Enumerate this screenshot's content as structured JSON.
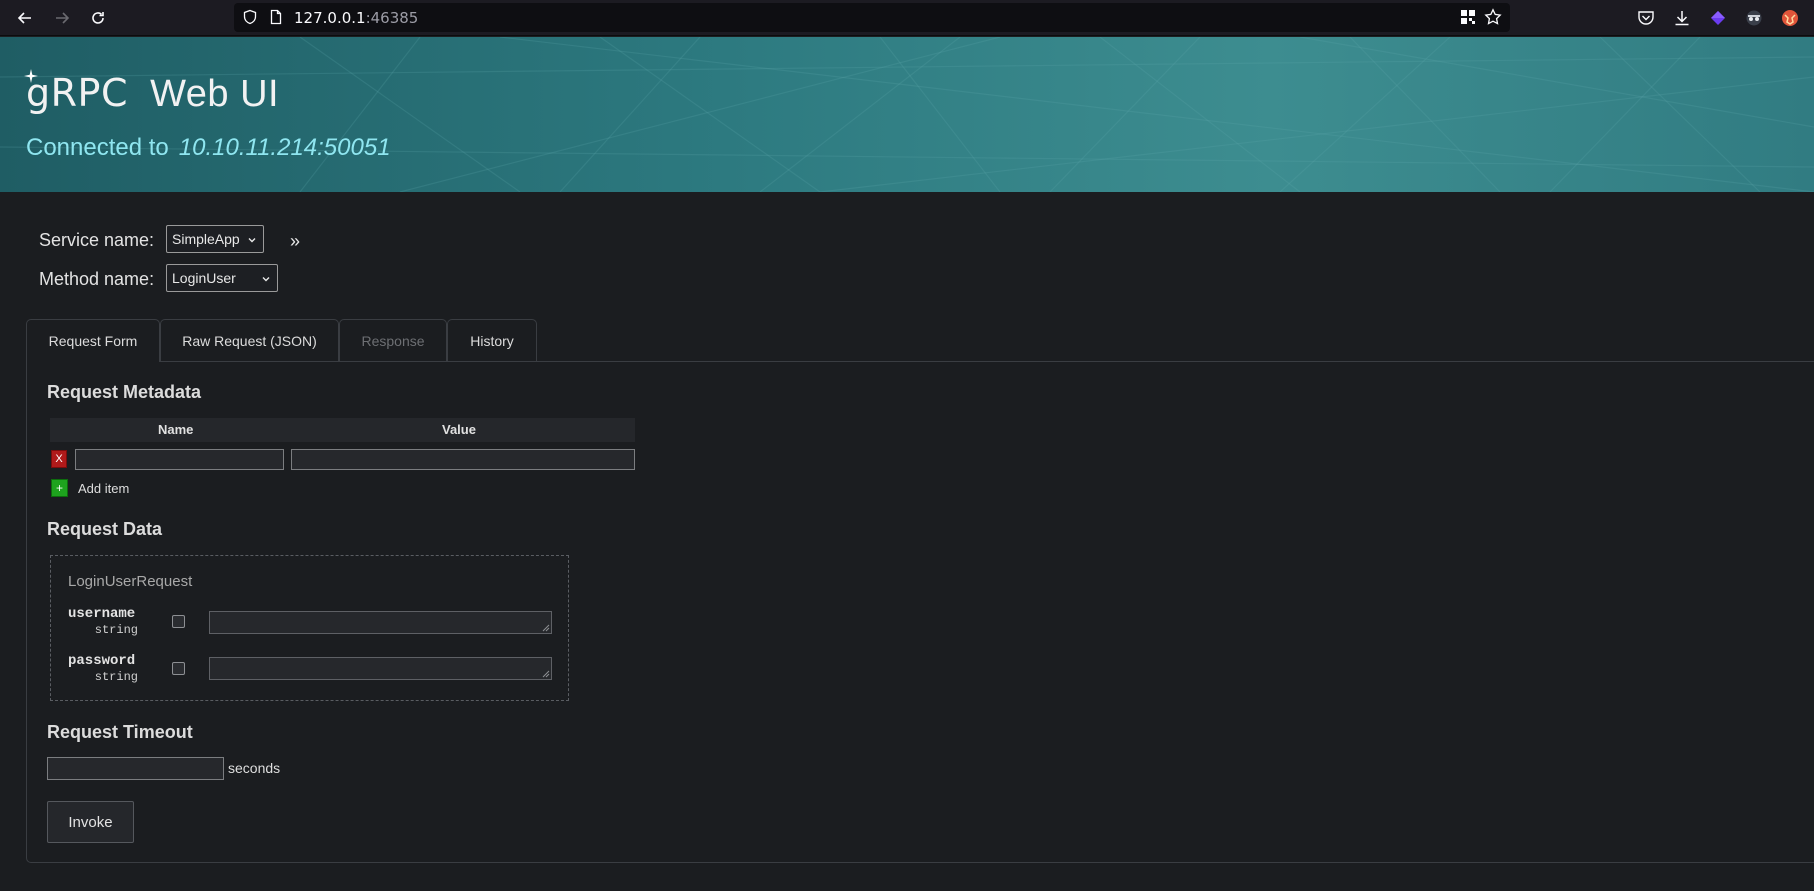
{
  "browser": {
    "url_host": "127.0.0.1",
    "url_port": ":46385"
  },
  "header": {
    "logo_text": "gRPC",
    "title": "Web UI",
    "connected_label": "Connected to",
    "connected_address": "10.10.11.214:50051"
  },
  "selectors": {
    "service_label": "Service name:",
    "service_value": "SimpleApp",
    "method_label": "Method name:",
    "method_value": "LoginUser",
    "expand_label": "»"
  },
  "tabs": [
    {
      "label": "Request Form",
      "active": true
    },
    {
      "label": "Raw Request (JSON)",
      "active": false
    },
    {
      "label": "Response",
      "active": false,
      "disabled": true
    },
    {
      "label": "History",
      "active": false
    }
  ],
  "metadata": {
    "title": "Request Metadata",
    "col_name": "Name",
    "col_value": "Value",
    "remove_label": "X",
    "add_symbol": "+",
    "add_label": "Add item"
  },
  "request_data": {
    "title": "Request Data",
    "message_name": "LoginUserRequest",
    "fields": [
      {
        "name": "username",
        "type": "string"
      },
      {
        "name": "password",
        "type": "string"
      }
    ]
  },
  "timeout": {
    "title": "Request Timeout",
    "unit": "seconds"
  },
  "invoke_label": "Invoke",
  "colors": {
    "banner": "#2d7a80",
    "accent_text": "#8fe6f0",
    "background": "#1b1d20",
    "remove": "#b01a1a",
    "add": "#1ea31e"
  }
}
